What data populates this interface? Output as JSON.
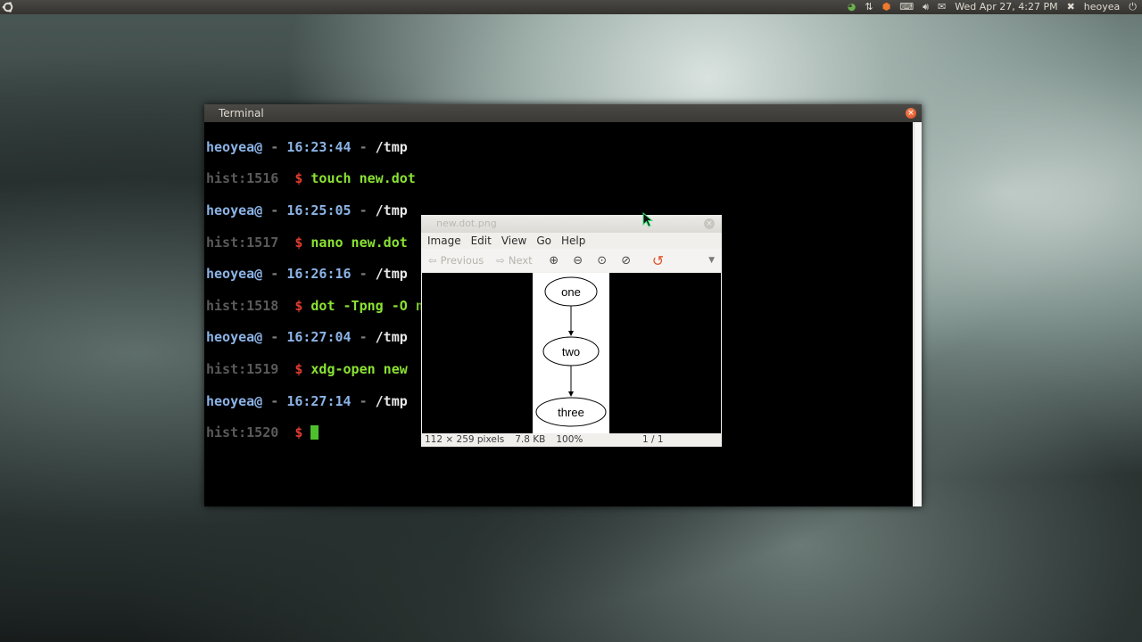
{
  "top_panel": {
    "clock": "Wed Apr 27,  4:27 PM",
    "user": "heoyea"
  },
  "terminal": {
    "title": "Terminal",
    "lines": [
      {
        "user": "heoyea@",
        "sep1": " - ",
        "time": "16:23:44",
        "sep2": " - ",
        "path": "/tmp"
      },
      {
        "hist": "hist:1516",
        "dollar": "$",
        "cmd": "touch new.dot"
      },
      {
        "user": "heoyea@",
        "sep1": " - ",
        "time": "16:25:05",
        "sep2": " - ",
        "path": "/tmp"
      },
      {
        "hist": "hist:1517",
        "dollar": "$",
        "cmd": "nano new.dot"
      },
      {
        "user": "heoyea@",
        "sep1": " - ",
        "time": "16:26:16",
        "sep2": " - ",
        "path": "/tmp"
      },
      {
        "hist": "hist:1518",
        "dollar": "$",
        "cmd": "dot -Tpng -O new.dot"
      },
      {
        "user": "heoyea@",
        "sep1": " - ",
        "time": "16:27:04",
        "sep2": " - ",
        "path": "/tmp"
      },
      {
        "hist": "hist:1519",
        "dollar": "$",
        "cmd": "xdg-open new"
      },
      {
        "user": "heoyea@",
        "sep1": " - ",
        "time": "16:27:14",
        "sep2": " - ",
        "path": "/tmp"
      },
      {
        "hist": "hist:1520",
        "dollar": "$",
        "cmd": ""
      }
    ]
  },
  "viewer": {
    "title": "new.dot.png",
    "menu": [
      "Image",
      "Edit",
      "View",
      "Go",
      "Help"
    ],
    "toolbar": {
      "previous": "Previous",
      "next": "Next"
    },
    "graph_nodes": [
      "one",
      "two",
      "three"
    ],
    "status": {
      "dimensions": "112 × 259 pixels",
      "size": "7.8 KB",
      "zoom": "100%",
      "page": "1 / 1"
    }
  },
  "icons": {
    "ubuntu": "ubuntu-logo-icon",
    "network": "network-icon",
    "transfer": "transfer-arrows-icon",
    "updates": "update-manager-icon",
    "keyboard": "keyboard-icon",
    "volume": "volume-icon",
    "mail": "mail-icon",
    "session": "session-icon",
    "power": "power-icon"
  },
  "colors": {
    "prompt_user": "#8cb3e6",
    "prompt_dollar": "#e23c30",
    "command": "#8ae234",
    "cursor": "#4ec02e",
    "close_button": "#d8431b"
  }
}
